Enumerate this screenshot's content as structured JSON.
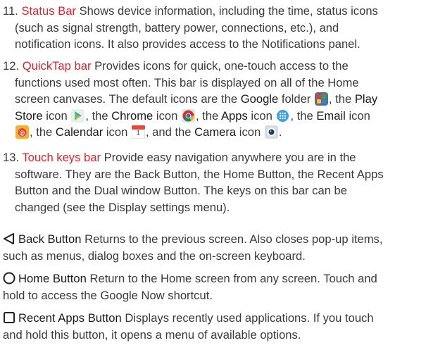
{
  "items": [
    {
      "number": "11.",
      "title": "Status Bar",
      "lines": [
        "Shows device information, including the time, status icons",
        "(such as signal strength, battery power, connections, etc.), and",
        "notification icons. It also provides access to the Notifications panel."
      ]
    },
    {
      "number": "12.",
      "title": "QuickTap bar",
      "line1": "Provides icons for quick, one-touch access to the",
      "line2": "functions used most often. This bar is displayed on all of the Home",
      "line3a": "screen canvases. The default icons are the ",
      "google": "Google",
      "line3b": " folder ",
      "line3c": ", the ",
      "play": "Play",
      "store": "Store",
      "line4a": " icon ",
      "line4b": ", the ",
      "chrome": "Chrome",
      "line4c": " icon ",
      "line4d": ", the ",
      "apps": "Apps",
      "line4e": " icon ",
      "line4f": ", the ",
      "email": "Email",
      "line4g": " icon",
      "line5a": ", the ",
      "calendar": "Calendar",
      "line5b": " icon ",
      "line5c": ", and the ",
      "camera": "Camera",
      "line5d": " icon ",
      "line5e": ".",
      "calendar_icon_text": "1"
    },
    {
      "number": "13.",
      "title": "Touch keys bar",
      "lines": [
        "Provide easy navigation anywhere you are in the",
        "software. They are the Back Button, the Home Button, the Recent Apps",
        "Button and the Dual window Button. The keys on this bar can be",
        "changed (see the Display settings menu)."
      ]
    }
  ],
  "buttons": [
    {
      "icon": "back-triangle-icon",
      "title": "Back Button",
      "lines": [
        "Returns to the previous screen. Also closes pop-up items,",
        "such as menus, dialog boxes and the on-screen keyboard."
      ]
    },
    {
      "icon": "home-circle-icon",
      "title": "Home Button",
      "lines": [
        "Return to the Home screen from any screen. Touch and",
        "hold to access the Google Now shortcut."
      ]
    },
    {
      "icon": "recent-square-icon",
      "title": "Recent Apps Button",
      "lines": [
        "Displays recently used applications. If you touch",
        "and hold this button, it opens a menu of available options."
      ]
    }
  ],
  "colors": {
    "accent": "#e0232c",
    "text": "#3a3a3a"
  }
}
